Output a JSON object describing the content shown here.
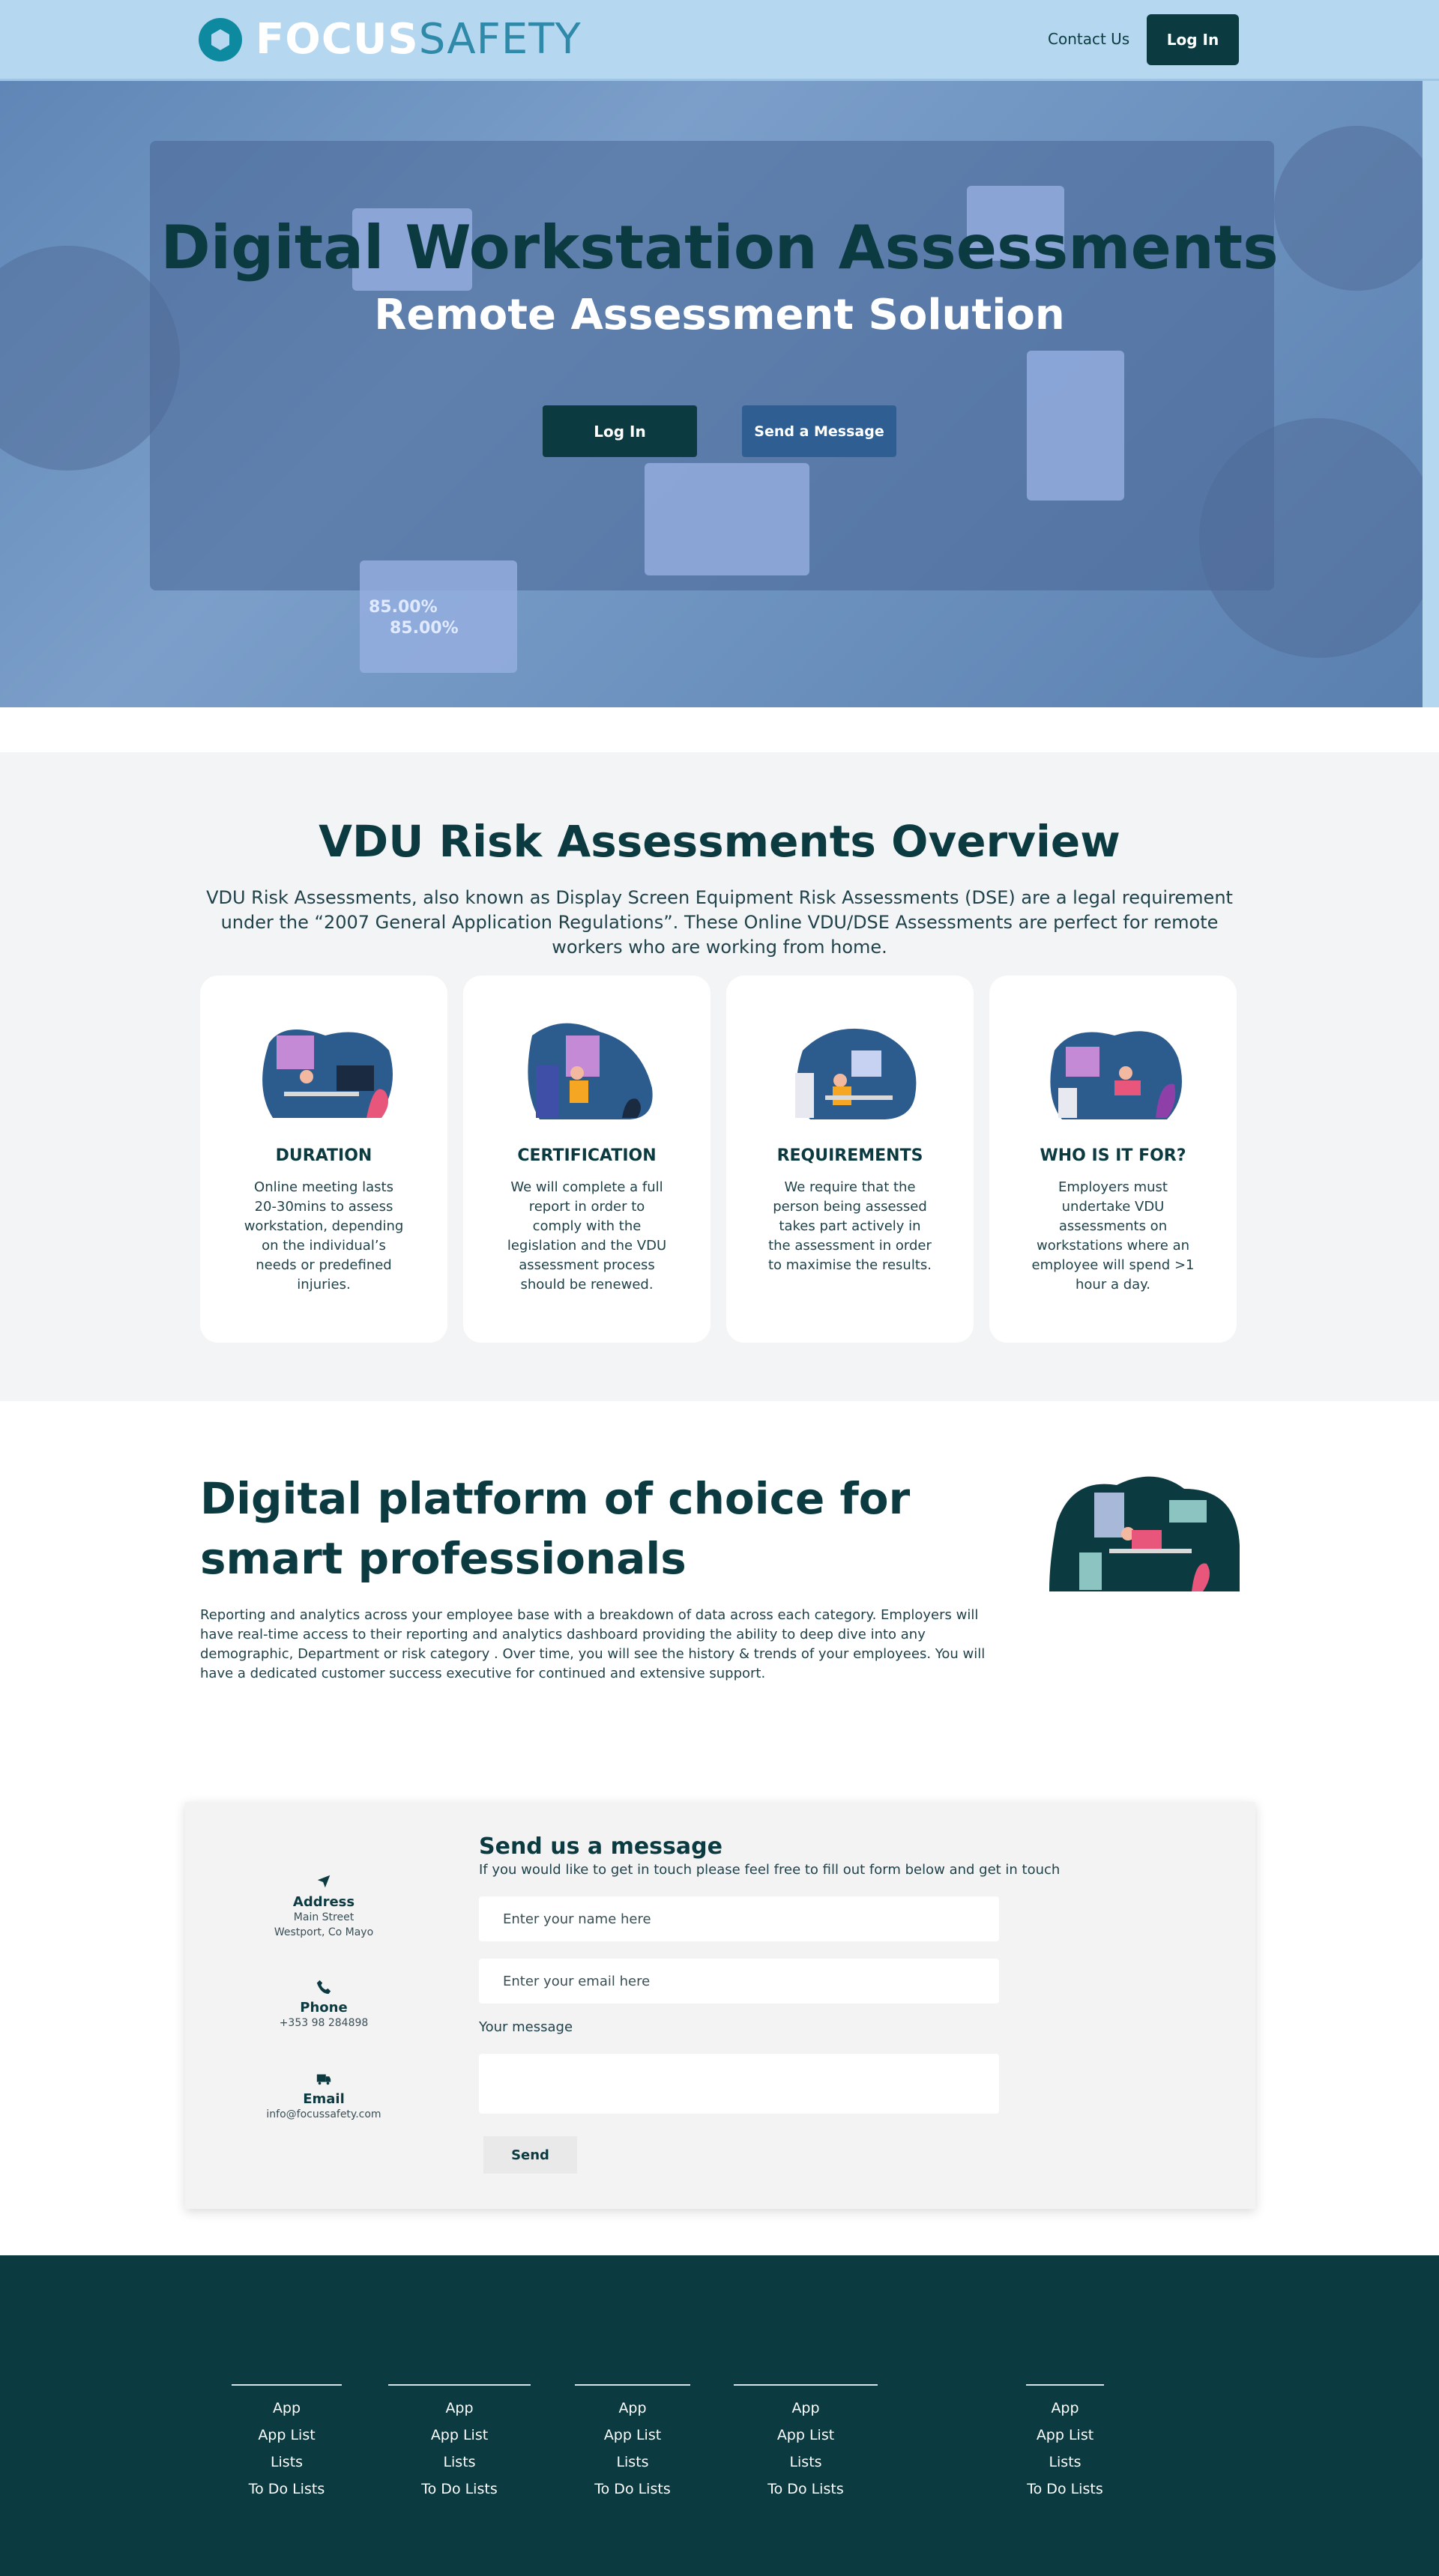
{
  "nav": {
    "logo_focus": "FOCUS",
    "logo_safety": "SAFETY",
    "contact_label": "Contact Us",
    "login_label": "Log In"
  },
  "hero": {
    "title": "Digital Workstation Assessments",
    "subtitle": "Remote Assessment Solution",
    "login_label": "Log In",
    "message_label": "Send a Message",
    "photo_stat_1": "85.00%",
    "photo_stat_2": "85.00%"
  },
  "overview": {
    "title": "VDU Risk Assessments Overview",
    "intro": "VDU Risk Assessments, also known as Display Screen Equipment Risk Assessments (DSE) are a legal requirement under the “2007 General Application Regulations”. These Online VDU/DSE Assessments are perfect for remote workers who are working from home.",
    "cards": [
      {
        "title": "DURATION",
        "text": "Online meeting lasts 20-30mins to assess workstation, depending on the individual’s needs or predefined injuries."
      },
      {
        "title": "CERTIFICATION",
        "text": "We will complete a full report in order to comply with the legislation and the VDU assessment process should be renewed."
      },
      {
        "title": "REQUIREMENTS",
        "text": "We require that the person being assessed takes part actively in the assessment in order to maximise the results."
      },
      {
        "title": "WHO IS IT FOR?",
        "text": "Employers must undertake VDU assessments on workstations where an employee will spend >1 hour a day."
      }
    ]
  },
  "platform": {
    "title": "Digital platform of choice for smart professionals",
    "text": "Reporting and analytics across your employee base with a breakdown of data across each category. Employers will have real-time access to their reporting and analytics dashboard providing the ability to deep dive into any demographic, Department or risk category . Over time, you will see the history & trends of your employees. You will have a dedicated customer success executive for continued and extensive support."
  },
  "contact": {
    "address_head": "Address",
    "address_line1": "Main Street",
    "address_line2": "Westport, Co Mayo",
    "phone_head": "Phone",
    "phone_value": "+353 98 284898",
    "email_head": "Email",
    "email_value": "info@focussafety.com",
    "form_title": "Send us a message",
    "form_subtitle": "If you would like to get in touch please feel free to fill out form below and get in touch",
    "name_placeholder": "Enter your name here",
    "email_placeholder": "Enter your email here",
    "message_label": "Your message",
    "send_label": "Send"
  },
  "footer": {
    "columns": [
      {
        "links": [
          "App",
          "App List",
          "Lists",
          "To Do Lists"
        ]
      },
      {
        "links": [
          "App",
          "App List",
          "Lists",
          "To Do Lists"
        ]
      },
      {
        "links": [
          "App",
          "App List",
          "Lists",
          "To Do Lists"
        ]
      },
      {
        "links": [
          "App",
          "App List",
          "Lists",
          "To Do Lists"
        ]
      },
      {
        "links": [
          "App",
          "App List",
          "Lists",
          "To Do Lists"
        ]
      }
    ]
  },
  "colors": {
    "primary_dark": "#0b3b40",
    "nav_bg": "#b5d7f0",
    "hero_overlay": "#7ea4cf",
    "secondary_button": "#2f5f92",
    "section_bg": "#f3f4f6"
  },
  "icons": {
    "address": "navigation-arrow-icon",
    "phone": "phone-icon",
    "email": "email-truck-icon"
  }
}
